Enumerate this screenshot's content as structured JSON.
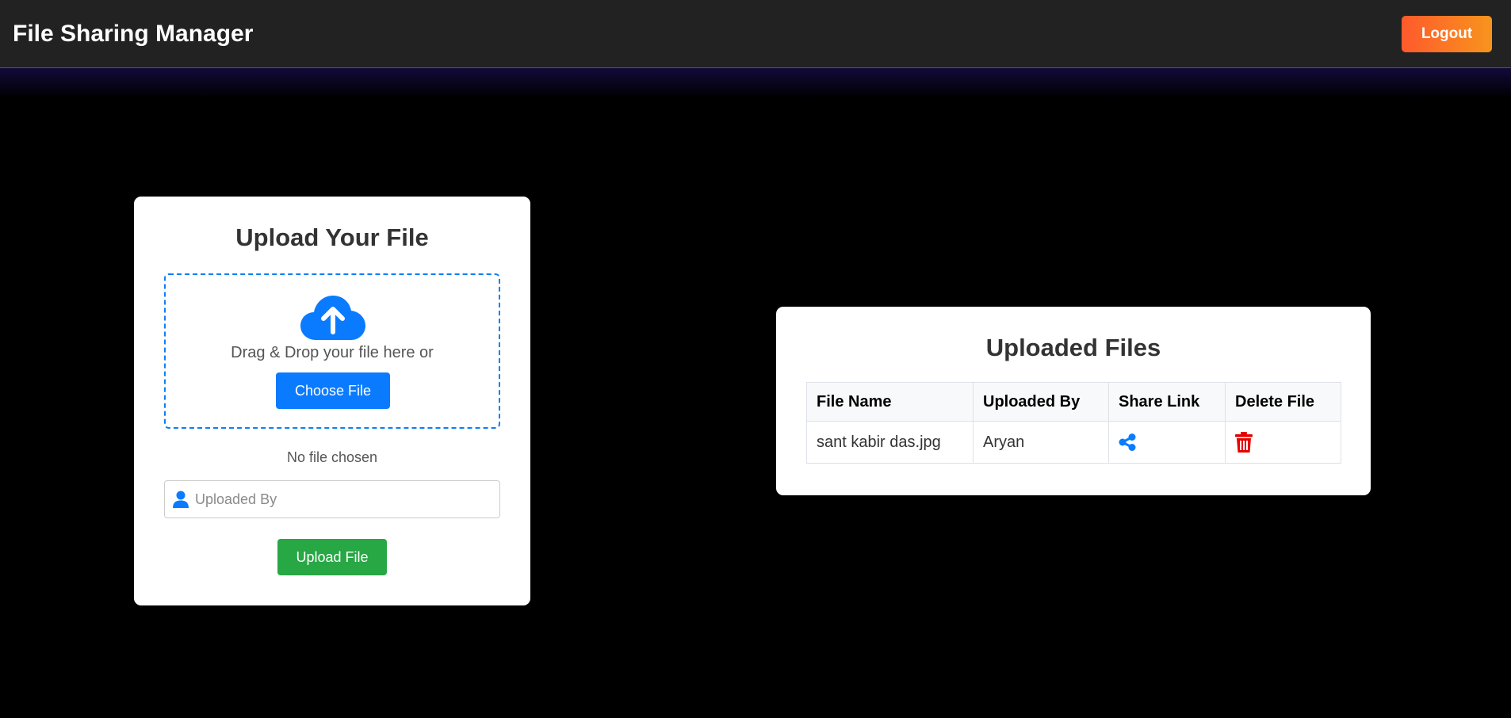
{
  "header": {
    "title": "File Sharing Manager",
    "logout_label": "Logout"
  },
  "upload": {
    "title": "Upload Your File",
    "drop_text": "Drag & Drop your file here or",
    "choose_label": "Choose File",
    "file_status": "No file chosen",
    "uploader_placeholder": "Uploaded By",
    "uploader_value": "",
    "upload_label": "Upload File"
  },
  "files": {
    "title": "Uploaded Files",
    "columns": [
      "File Name",
      "Uploaded By",
      "Share Link",
      "Delete File"
    ],
    "rows": [
      {
        "file_name": "sant kabir das.jpg",
        "uploaded_by": "Aryan",
        "share_icon": "share-icon",
        "delete_icon": "trash-icon"
      }
    ]
  },
  "colors": {
    "accent_blue": "#0a7bff",
    "upload_green": "#28a745",
    "delete_red": "#e60000",
    "logout_gradient": [
      "#ff5a2c",
      "#f7941d"
    ]
  }
}
